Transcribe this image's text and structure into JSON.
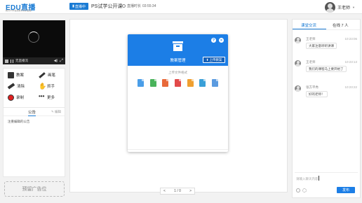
{
  "header": {
    "logo_text": "EDU直播",
    "logo_sub": "教育LIVE在线教育培训直播",
    "live_badge": "直播中",
    "course_title": "PS试学公开课",
    "timer_label": "直播时长",
    "timer_value": "03:55:34",
    "user_name": "王老师"
  },
  "video": {
    "status_label": "无直播流"
  },
  "tools": {
    "items": [
      {
        "label": "教案",
        "icon": "lesson-plan-icon"
      },
      {
        "label": "画笔",
        "icon": "pen-icon"
      },
      {
        "label": "清除",
        "icon": "eraser-icon"
      },
      {
        "label": "抓手",
        "icon": "hand-icon"
      },
      {
        "label": "录制",
        "icon": "record-icon"
      },
      {
        "label": "更多",
        "icon": "more-icon"
      }
    ]
  },
  "notice": {
    "tab_label": "公告",
    "edit_label": "编辑",
    "content": "注重编辑的公告"
  },
  "ad": {
    "label": "预留广告位"
  },
  "modal": {
    "title": "教案管理",
    "upload_label": "上传教案",
    "help_label": "?",
    "close_label": "×",
    "format_label": "上传文件格式",
    "file_types": [
      {
        "name": "doc",
        "color": "#4a9ee8"
      },
      {
        "name": "xls",
        "color": "#49b35b"
      },
      {
        "name": "ppt",
        "color": "#e8693a"
      },
      {
        "name": "pdf",
        "color": "#e24a4a"
      },
      {
        "name": "txt",
        "color": "#f0a030"
      },
      {
        "name": "img",
        "color": "#3aa0d8"
      },
      {
        "name": "file",
        "color": "#5b9be0"
      }
    ]
  },
  "pager": {
    "prev": "<",
    "page": "1 / 0",
    "next": ">"
  },
  "chat": {
    "tab_chat": "课堂交流",
    "tab_online": "在线 7 人",
    "messages": [
      {
        "name": "王老师",
        "time": "10:23:06",
        "text": "大家注意听听讲课"
      },
      {
        "name": "王老师",
        "time": "10:23:13",
        "text": "我们的课程马上要开始了"
      },
      {
        "name": "张方平秀",
        "time": "10:23:22",
        "text": "好的老师！"
      }
    ],
    "input_placeholder": "请输入聊天内容",
    "send_label": "发布"
  },
  "colors": {
    "accent": "#1c7ee6",
    "record": "#e02020"
  }
}
